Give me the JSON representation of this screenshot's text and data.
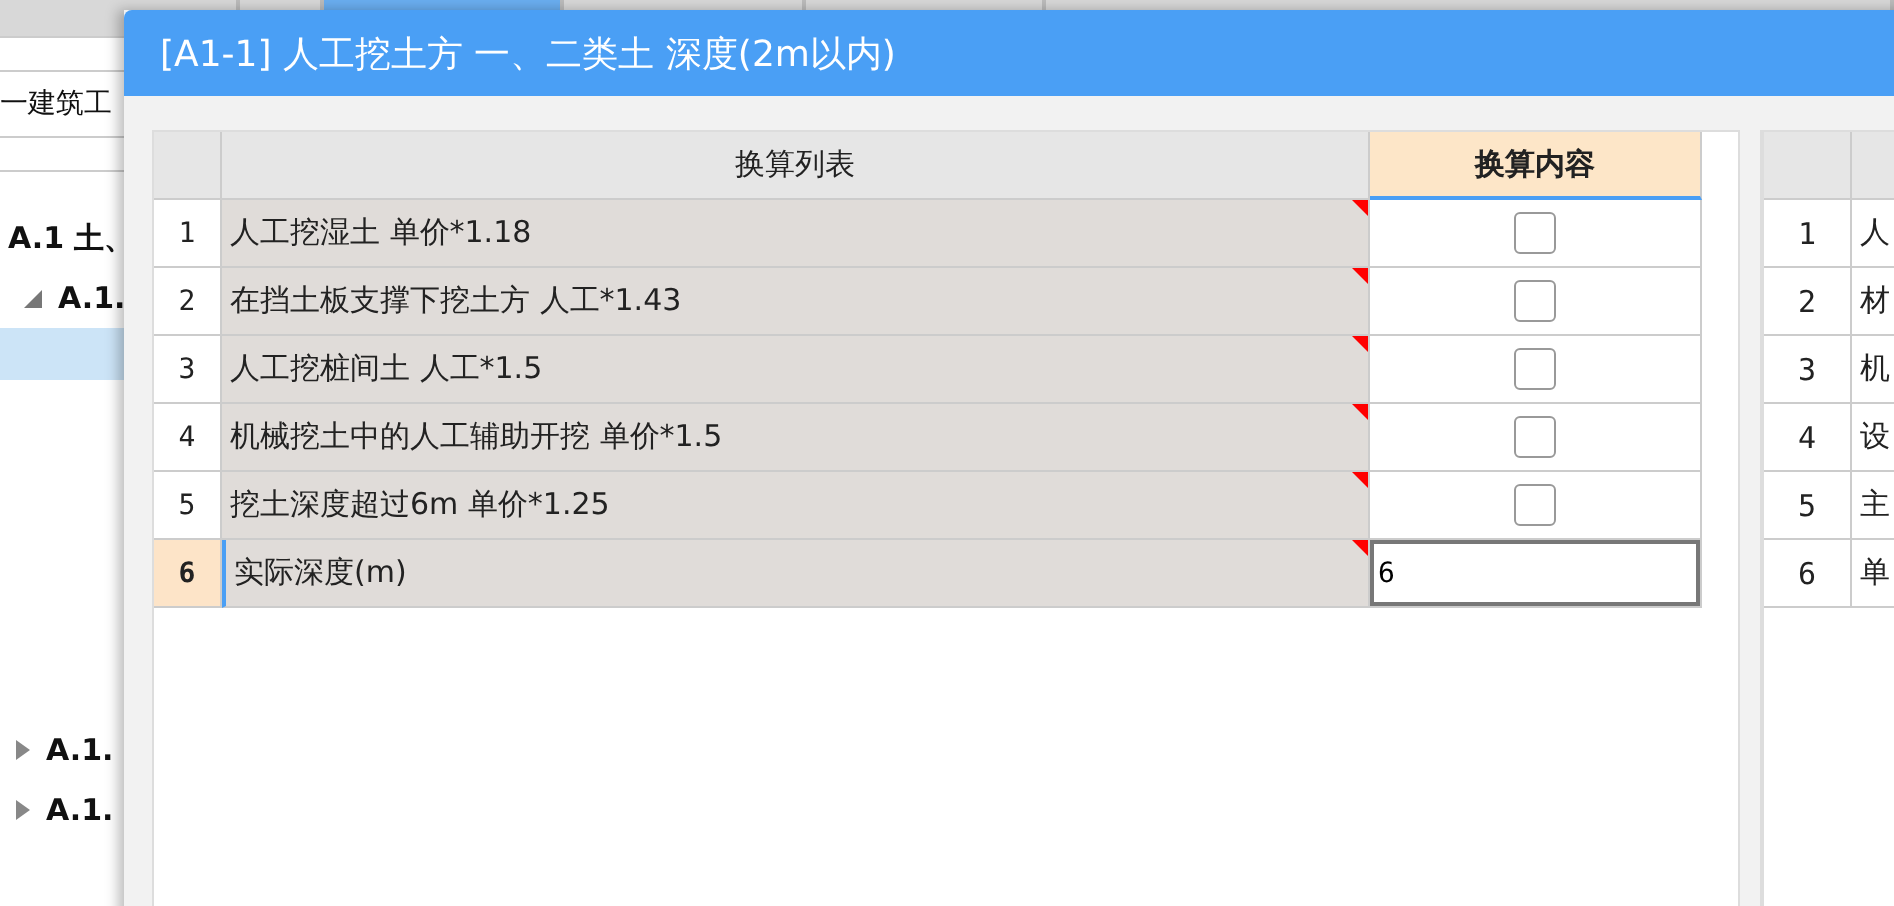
{
  "background": {
    "tabs": [
      {
        "selected": false
      },
      {
        "selected": false
      },
      {
        "selected": true
      },
      {
        "selected": false
      },
      {
        "selected": false
      },
      {
        "selected": false
      }
    ],
    "name_field": "一建筑工",
    "tree": [
      {
        "label": "A.1 土、",
        "selected": false,
        "children": [
          {
            "label": "A.1.",
            "expanded": true,
            "selected": false,
            "children": [
              {
                "selected": true
              }
            ]
          }
        ]
      },
      {
        "label": "A.1.",
        "expanded": false,
        "selected": false
      },
      {
        "label": "A.1.",
        "expanded": false,
        "selected": false
      }
    ]
  },
  "dialog": {
    "title": "[A1-1] 人工挖土方 一、二类土 深度(2m以内)",
    "table": {
      "columns": [
        "换算列表",
        "换算内容"
      ],
      "rows": [
        {
          "number": "1",
          "text": "人工挖湿土 单价*1.18",
          "kind": "checkbox",
          "checked": false,
          "selected": false
        },
        {
          "number": "2",
          "text": "在挡土板支撑下挖土方 人工*1.43",
          "kind": "checkbox",
          "checked": false,
          "selected": false
        },
        {
          "number": "3",
          "text": "人工挖桩间土 人工*1.5",
          "kind": "checkbox",
          "checked": false,
          "selected": false
        },
        {
          "number": "4",
          "text": "机械挖土中的人工辅助开挖 单价*1.5",
          "kind": "checkbox",
          "checked": false,
          "selected": false
        },
        {
          "number": "5",
          "text": "挖土深度超过6m 单价*1.25",
          "kind": "checkbox",
          "checked": false,
          "selected": false
        },
        {
          "number": "6",
          "text": "实际深度(m)",
          "kind": "input",
          "value": "6",
          "selected": true
        }
      ]
    },
    "side_table": {
      "rows": [
        {
          "number": "1",
          "text": "人"
        },
        {
          "number": "2",
          "text": "材"
        },
        {
          "number": "3",
          "text": "机"
        },
        {
          "number": "4",
          "text": "设"
        },
        {
          "number": "5",
          "text": "主"
        },
        {
          "number": "6",
          "text": "单"
        }
      ]
    }
  }
}
